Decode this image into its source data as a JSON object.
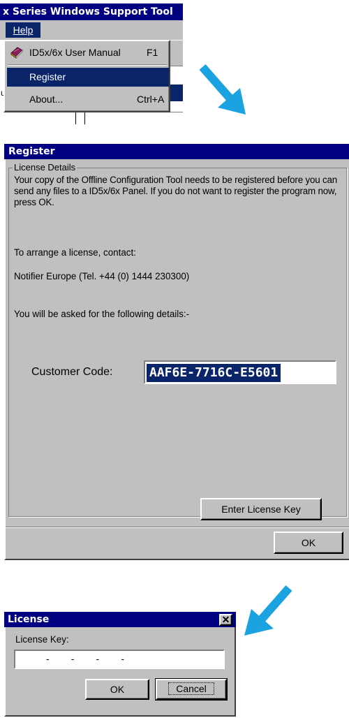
{
  "colors": {
    "title_bg": "#000080",
    "dialog_bg": "#c0c0c0",
    "selection": "#0a246a",
    "arrow": "#1aa3e0"
  },
  "app": {
    "title": "x Series Windows Support Tool"
  },
  "help_menu": {
    "menu_label": "Help",
    "items": [
      {
        "label": "ID5x/6x User Manual",
        "shortcut": "F1",
        "icon": "book-icon"
      },
      {
        "label": "Register",
        "shortcut": ""
      },
      {
        "label": "About...",
        "shortcut": "Ctrl+A"
      }
    ]
  },
  "register_dialog": {
    "title": "Register",
    "group_label": "License Details",
    "intro": "Your copy of the Offline Configuration Tool needs to be registered before you can send any files to a ID5x/6x Panel. If you do not want to register the program now, press OK.",
    "arrange": "To arrange a license, contact:",
    "contact": "Notifier Europe (Tel. +44 (0) 1444 230300)",
    "details": "You will be asked for the following details:-",
    "customer_code_label": "Customer Code:",
    "customer_code": "AAF6E-7716C-E5601",
    "enter_key_button": "Enter License Key",
    "ok_button": "OK"
  },
  "license_dialog": {
    "title": "License",
    "key_label": "License Key:",
    "key_placeholder": "-        -        -        -",
    "ok_button": "OK",
    "cancel_button": "Cancel"
  }
}
